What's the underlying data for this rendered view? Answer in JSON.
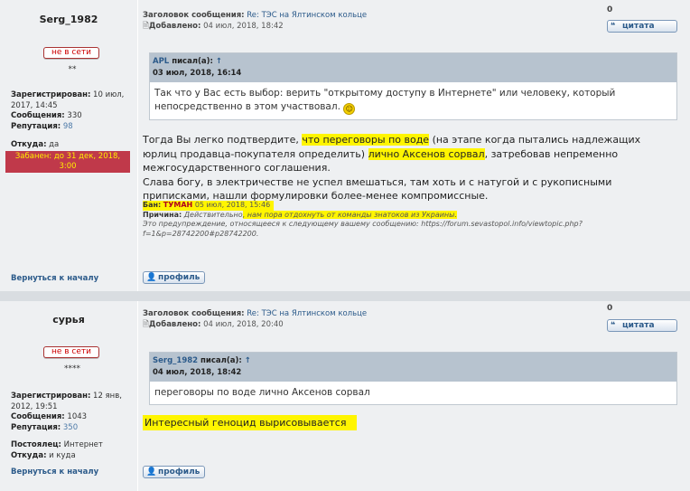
{
  "labels": {
    "subject": "Заголовок сообщения:",
    "added": "Добавлено:",
    "registered": "Зарегистрирован:",
    "messages": "Сообщения:",
    "reputation": "Репутация:",
    "from": "Откуда:",
    "regular": "Постоялец:",
    "wrote": "писал(а):",
    "back_to_top": "Вернуться к началу",
    "profile_btn": "профиль",
    "quote_btn": "цитата",
    "offline": "не в сети",
    "up_arrow": "↑",
    "ban_label": "Бан:",
    "reason_label": "Причина:"
  },
  "posts": [
    {
      "username": "Serg_1982",
      "stars": "**",
      "registered": "10 июл, 2017, 14:45",
      "messages": "330",
      "reputation": "98",
      "from": "да",
      "banned": "Забанен: до 31 дек, 2018, 3:00",
      "subject": "Re: ТЭС на Ялтинском кольце",
      "added": "04 июл, 2018, 18:42",
      "score": "0",
      "quote_author": "APL",
      "quote_date": "03 июл, 2018, 16:14",
      "quote_text": "Так что у Вас есть выбор: верить \"открытому доступу в Интернете\" или человеку, который непосредственно в этом участвовал.",
      "body_1": "Тогда Вы легко подтвердите, ",
      "body_hl1": "что переговоры по воде",
      "body_2": " (на этапе когда пытались надлежащих юрлиц продавца-покупателя определить) ",
      "body_hl2": "лично Аксенов сорвал",
      "body_3": ", затребовав непременно межгосударственного соглашения.",
      "body_4": "Слава богу, в электричестве не успел вмешаться, там хоть и с натугой и с рукописными приписками, нашли формулировки более-менее компромиссные.",
      "ban_moderator": "ТУМАН",
      "ban_date": "05 июл, 2018, 15:46",
      "ban_reason_1": "Действительно",
      "ban_reason_hl": ", нам пора отдохнуть от команды знатоков из Украины.",
      "ban_footer": "Это предупреждение, относящееся к следующему вашему сообщению: https://forum.sevastopol.info/viewtopic.php?f=1&p=28742200#p28742200."
    },
    {
      "username": "сурья",
      "stars": "****",
      "registered": "12 янв, 2012, 19:51",
      "messages": "1043",
      "reputation": "350",
      "regular": "Интернет",
      "from": "и куда",
      "subject": "Re: ТЭС на Ялтинском кольце",
      "added": "04 июл, 2018, 20:40",
      "score": "0",
      "quote_author": "Serg_1982",
      "quote_date": "04 июл, 2018, 18:42",
      "quote_text": "переговоры по воде лично Аксенов сорвал",
      "body_hl": "Интересный геноцид вырисовывается"
    }
  ],
  "colors": {
    "highlight": "#fff500",
    "ban_bg": "#c0394a",
    "ban_text": "#ffee00",
    "link": "#2b5a8a",
    "quote_header": "#b7c3cf"
  }
}
